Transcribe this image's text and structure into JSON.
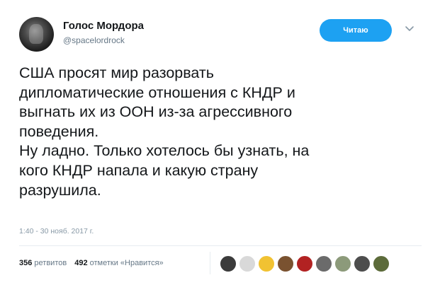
{
  "author": {
    "display_name": "Голос Мордора",
    "username": "@spacelordrock",
    "avatar_icon": "avatar-image"
  },
  "follow_button": {
    "label": "Читаю",
    "color": "#1da1f2"
  },
  "menu_icon": "chevron-down-icon",
  "tweet": {
    "text": "США просят мир разорвать\nдипломатические отношения с КНДР и\nвыгнать их из ООН из-за агрессивного\nповедения.\nНу ладно. Только хотелось бы узнать, на\nкого КНДР напала и какую страну\nразрушила."
  },
  "timestamp": "1:40 - 30 нояб. 2017 г.",
  "stats": {
    "retweets_count": "356",
    "retweets_label": "ретвитов",
    "likes_count": "492",
    "likes_label": "отметки «Нравится»"
  },
  "likers": [
    {
      "name": "liker-avatar-1",
      "color": "#3b3b3b"
    },
    {
      "name": "liker-avatar-2",
      "color": "#d9d9d9"
    },
    {
      "name": "liker-avatar-3",
      "color": "#f1c232"
    },
    {
      "name": "liker-avatar-4",
      "color": "#7a5230"
    },
    {
      "name": "liker-avatar-5",
      "color": "#b22222"
    },
    {
      "name": "liker-avatar-6",
      "color": "#6b6b6b"
    },
    {
      "name": "liker-avatar-7",
      "color": "#8c9a7a"
    },
    {
      "name": "liker-avatar-8",
      "color": "#4d4d4d"
    },
    {
      "name": "liker-avatar-9",
      "color": "#5c6b3a"
    }
  ]
}
